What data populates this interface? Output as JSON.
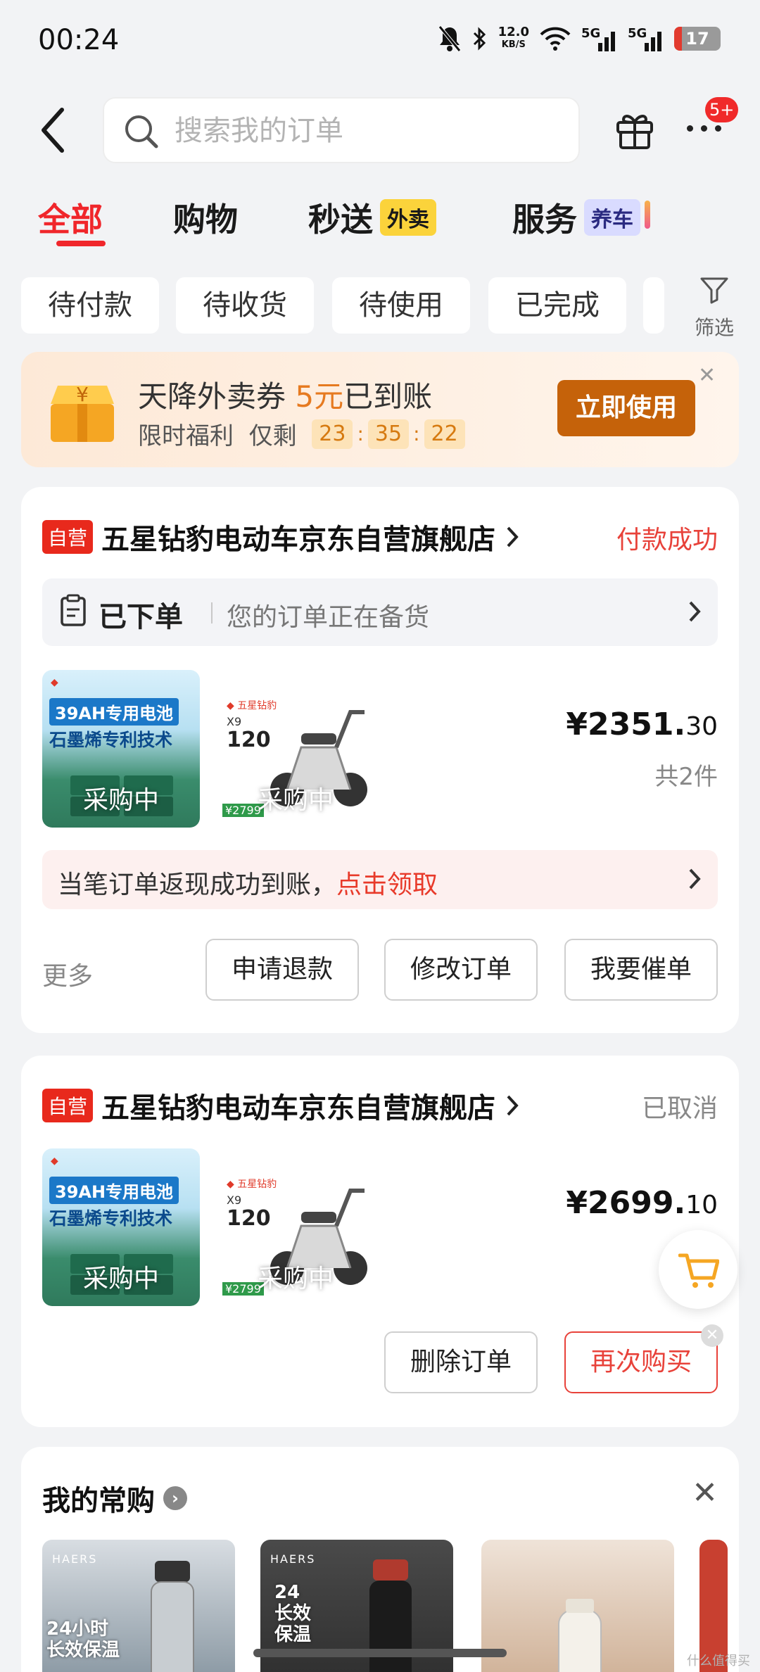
{
  "status_bar": {
    "time": "00:24",
    "net_speed_value": "12.0",
    "net_speed_unit": "KB/S",
    "signal1": "5G",
    "signal2": "5G",
    "battery": "17",
    "battery_level_percent": 17
  },
  "header": {
    "search_placeholder": "搜索我的订单",
    "more_badge": "5+"
  },
  "tabs": [
    {
      "label": "全部",
      "active": true
    },
    {
      "label": "购物",
      "active": false
    },
    {
      "label": "秒送",
      "tag": "外卖",
      "active": false
    },
    {
      "label": "服务",
      "tag": "养车",
      "active": false
    }
  ],
  "filters": [
    "待付款",
    "待收货",
    "待使用",
    "已完成"
  ],
  "filter_button": "筛选",
  "promo": {
    "text_a": "天降外卖券",
    "text_highlight": "5元",
    "text_b": "已到账",
    "sub_a": "限时福利",
    "sub_b": "仅剩",
    "countdown": [
      "23",
      "35",
      "22"
    ],
    "button": "立即使用"
  },
  "orders": [
    {
      "badge": "自营",
      "shop": "五星钻豹电动车京东自营旗舰店",
      "status": "付款成功",
      "status_color": "#e8423a",
      "tracking_title": "已下单",
      "tracking_desc": "您的订单正在备货",
      "items": [
        {
          "label": "采购中",
          "lines": [
            "39AH专用电池",
            "石墨烯专利技术"
          ],
          "type": "battery"
        },
        {
          "label": "采购中",
          "model": "X9",
          "range": "120",
          "price_tag": "¥2799",
          "type": "scooter"
        }
      ],
      "price_main": "¥2351.",
      "price_dec": "30",
      "count": "共2件",
      "cashback_text": "当笔订单返现成功到账，",
      "cashback_link": "点击领取",
      "more": "更多",
      "buttons": [
        "申请退款",
        "修改订单",
        "我要催单"
      ]
    },
    {
      "badge": "自营",
      "shop": "五星钻豹电动车京东自营旗舰店",
      "status": "已取消",
      "status_color": "#888888",
      "items": [
        {
          "label": "采购中",
          "lines": [
            "39AH专用电池",
            "石墨烯专利技术"
          ],
          "type": "battery"
        },
        {
          "label": "采购中",
          "model": "X9",
          "range": "120",
          "price_tag": "¥2799",
          "type": "scooter"
        }
      ],
      "price_main": "¥2699.",
      "price_dec": "10",
      "buttons": [
        "删除订单",
        "再次购买"
      ]
    }
  ],
  "frequent": {
    "title": "我的常购",
    "items": [
      {
        "brand": "HAERS",
        "text": "24小时\n长效保温"
      },
      {
        "brand": "HAERS",
        "text": "24\n长效\n保温"
      },
      {
        "brand": "",
        "text": ""
      },
      {
        "brand": "",
        "text": ""
      }
    ]
  },
  "watermark": "什么值得买"
}
